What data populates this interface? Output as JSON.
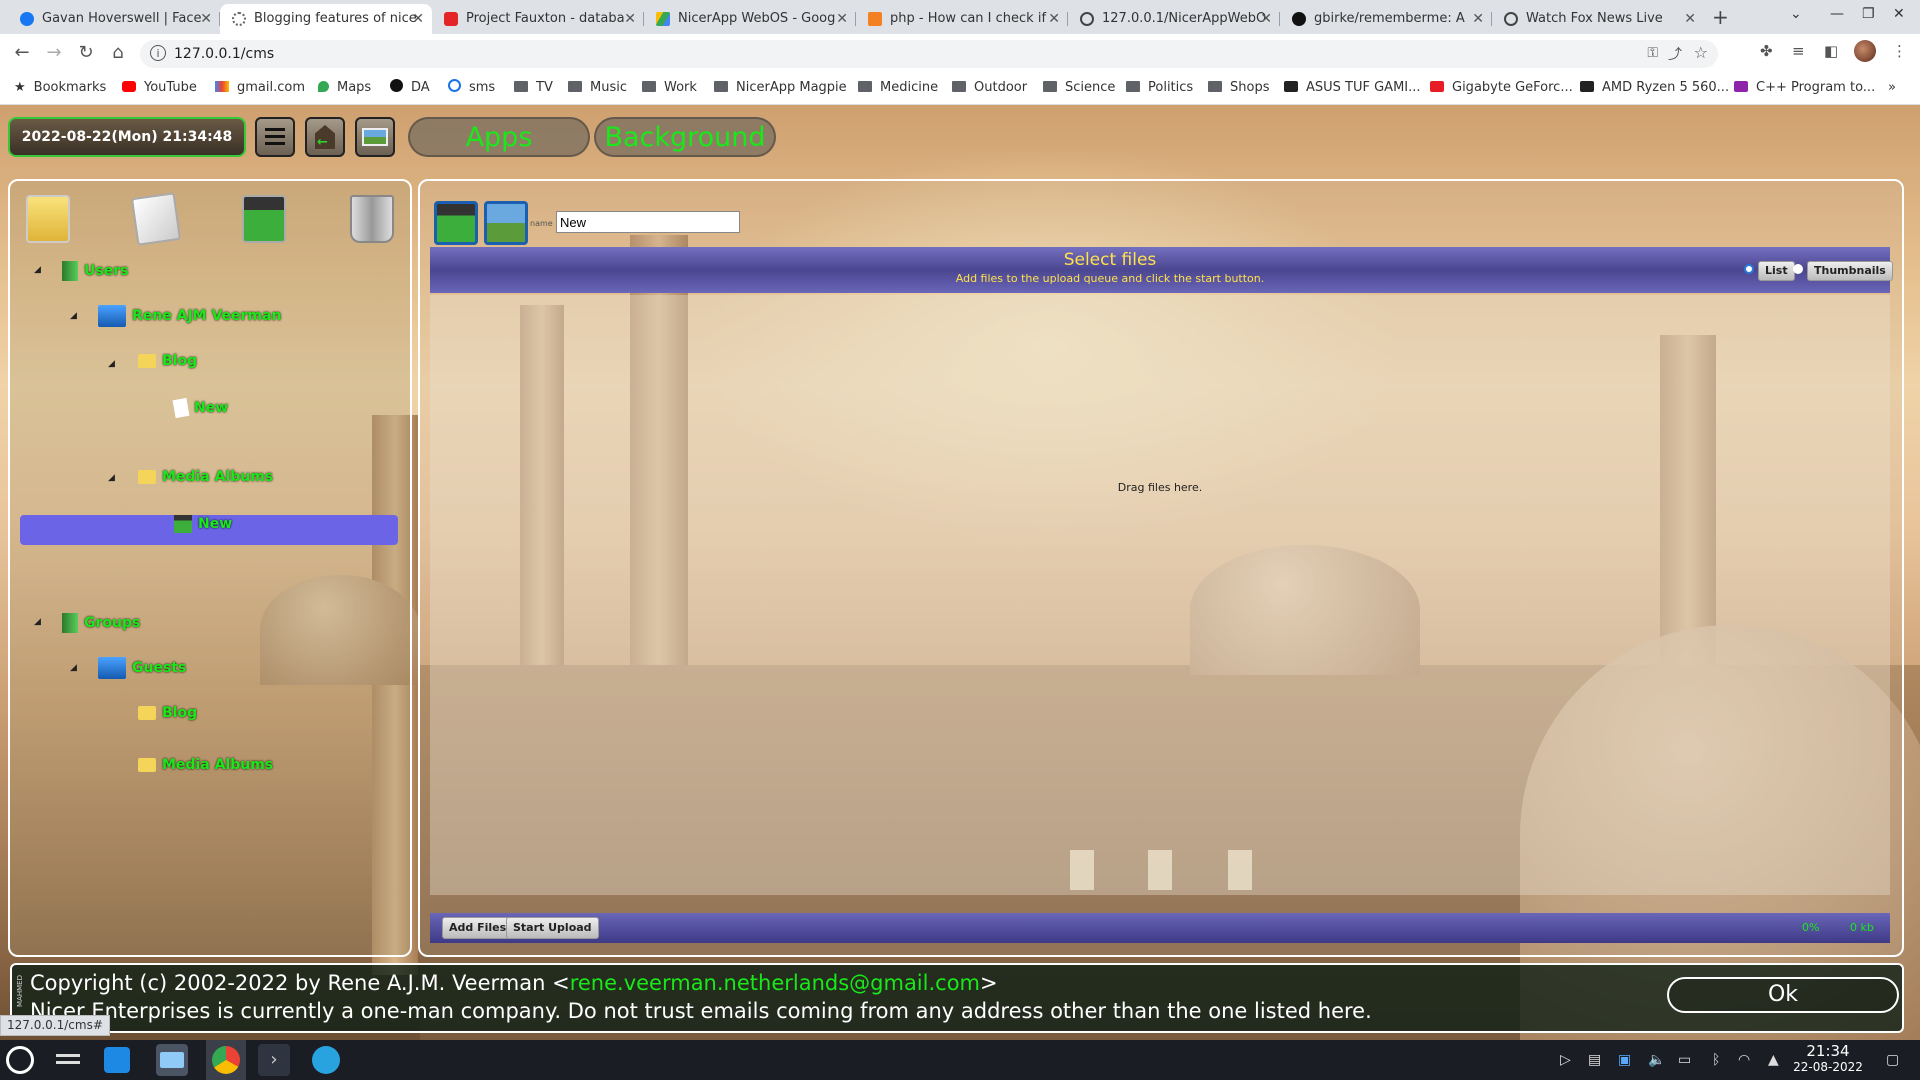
{
  "browser": {
    "tabs": [
      {
        "title": "Gavan Hoverswell | Face",
        "icon": "facebook-icon",
        "color": "#1877f2"
      },
      {
        "title": "Blogging features of nice",
        "icon": "loading-icon",
        "color": "#666666"
      },
      {
        "title": "Project Fauxton - databa",
        "icon": "couchdb-icon",
        "color": "#e42528"
      },
      {
        "title": "NicerApp WebOS - Goog",
        "icon": "google-drive-icon",
        "color": "#34a853"
      },
      {
        "title": "php - How can I check if",
        "icon": "stackoverflow-icon",
        "color": "#f48024"
      },
      {
        "title": "127.0.0.1/NicerAppWebO",
        "icon": "globe-icon",
        "color": "#444444"
      },
      {
        "title": "gbirke/rememberme: A",
        "icon": "github-icon",
        "color": "#111111"
      },
      {
        "title": "Watch Fox News Live",
        "icon": "globe-icon",
        "color": "#444444"
      }
    ],
    "active_tab": 1,
    "url": "127.0.0.1/cms",
    "bookmarks": [
      {
        "label": "Bookmarks",
        "icon": "star-icon"
      },
      {
        "label": "YouTube",
        "icon": "youtube-icon"
      },
      {
        "label": "gmail.com",
        "icon": "gmail-icon"
      },
      {
        "label": "Maps",
        "icon": "maps-icon"
      },
      {
        "label": "DA",
        "icon": "github-icon"
      },
      {
        "label": "sms",
        "icon": "sms-icon"
      },
      {
        "label": "TV",
        "icon": "folder-icon"
      },
      {
        "label": "Music",
        "icon": "folder-icon"
      },
      {
        "label": "Work",
        "icon": "folder-icon"
      },
      {
        "label": "NicerApp Magpie",
        "icon": "folder-icon"
      },
      {
        "label": "Medicine",
        "icon": "folder-icon"
      },
      {
        "label": "Outdoor",
        "icon": "folder-icon"
      },
      {
        "label": "Science",
        "icon": "folder-icon"
      },
      {
        "label": "Politics",
        "icon": "folder-icon"
      },
      {
        "label": "Shops",
        "icon": "folder-icon"
      },
      {
        "label": "ASUS TUF GAMI...",
        "icon": "amazon-icon"
      },
      {
        "label": "Gigabyte GeForc...",
        "icon": "shop-icon"
      },
      {
        "label": "AMD Ryzen 5 560...",
        "icon": "amazon-icon"
      },
      {
        "label": "C++ Program to...",
        "icon": "site-icon"
      }
    ],
    "status_url": "127.0.0.1/cms#"
  },
  "app": {
    "datetime": "2022-08-22(Mon) 21:34:48",
    "apps_label": "Apps",
    "background_label": "Background",
    "accent_green": "#19e819",
    "tree": [
      {
        "label": "Users",
        "level": 0,
        "icon": "users-group-icon"
      },
      {
        "label": "Rene AJM Veerman",
        "level": 1,
        "icon": "user-icon"
      },
      {
        "label": "Blog",
        "level": 2,
        "icon": "folder-icon"
      },
      {
        "label": "New",
        "level": 3,
        "icon": "document-icon"
      },
      {
        "label": "Media Albums",
        "level": 2,
        "icon": "folder-icon"
      },
      {
        "label": "New",
        "level": 3,
        "icon": "media-album-icon",
        "selected": true
      },
      {
        "label": "Groups",
        "level": 0,
        "icon": "users-group-icon"
      },
      {
        "label": "Guests",
        "level": 1,
        "icon": "user-group-icon"
      },
      {
        "label": "Blog",
        "level": 2,
        "icon": "folder-icon"
      },
      {
        "label": "Media Albums",
        "level": 2,
        "icon": "folder-icon"
      }
    ],
    "name_label": "name",
    "name_value": "New",
    "uploader": {
      "title": "Select files",
      "subtitle": "Add files to the upload queue and click the start button.",
      "view_list": "List",
      "view_thumbnails": "Thumbnails",
      "drop_hint": "Drag files here.",
      "add_files": "Add Files",
      "start_upload": "Start Upload",
      "percent": "0%",
      "size": "0 kb"
    },
    "footer": {
      "copyright_prefix": "Copyright (c) 2002-2022 by Rene A.J.M. Veerman <",
      "email": "rene.veerman.netherlands@gmail.com",
      "copyright_suffix": ">",
      "notice": "Nicer Enterprises is currently a one-man company. Do not trust emails coming from any address other than the one listed here.",
      "ok": "Ok",
      "side_tag": "MAHMED"
    }
  },
  "taskbar": {
    "time": "21:34",
    "date": "22-08-2022"
  }
}
